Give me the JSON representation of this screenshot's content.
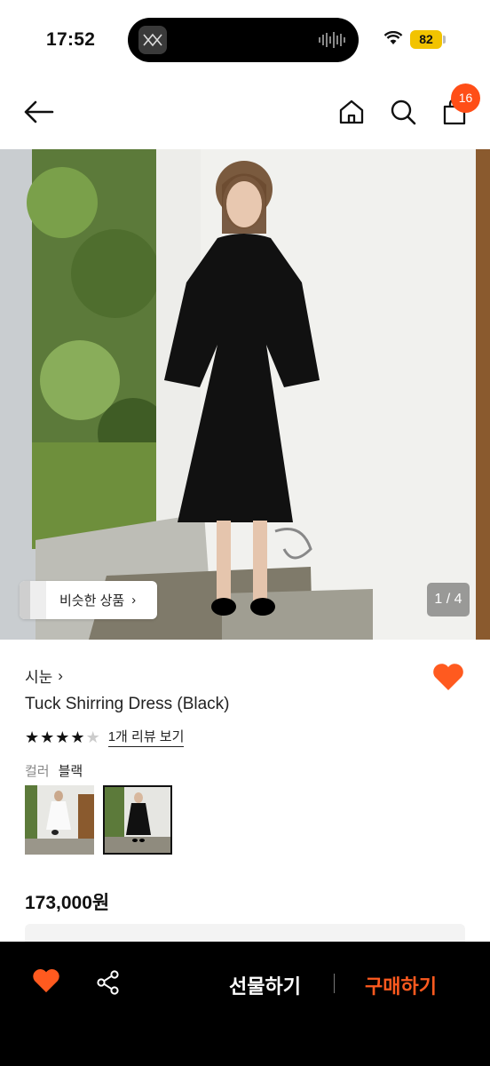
{
  "status_bar": {
    "time": "17:52",
    "battery": "82"
  },
  "nav": {
    "cart_count": "16",
    "icons": [
      "back-arrow-icon",
      "home-icon",
      "search-icon",
      "shopping-bag-icon"
    ]
  },
  "hero": {
    "page_indicator": "1 / 4",
    "similar_label": "비슷한 상품",
    "similar_chevron": "›"
  },
  "product": {
    "brand": "시눈",
    "brand_chevron": "›",
    "name": "Tuck Shirring Dress (Black)",
    "rating": 4,
    "rating_max": 5,
    "review_link": "1개 리뷰 보기",
    "color_label": "컬러",
    "color_value": "블랙",
    "swatches": [
      "white",
      "black"
    ],
    "selected_swatch": "black",
    "price": "173,000원"
  },
  "bottom_bar": {
    "gift_label": "선물하기",
    "buy_label": "구매하기"
  },
  "colors": {
    "accent": "#ff4e17",
    "heart": "#ff5a1f",
    "buy": "#ff5a1f"
  }
}
